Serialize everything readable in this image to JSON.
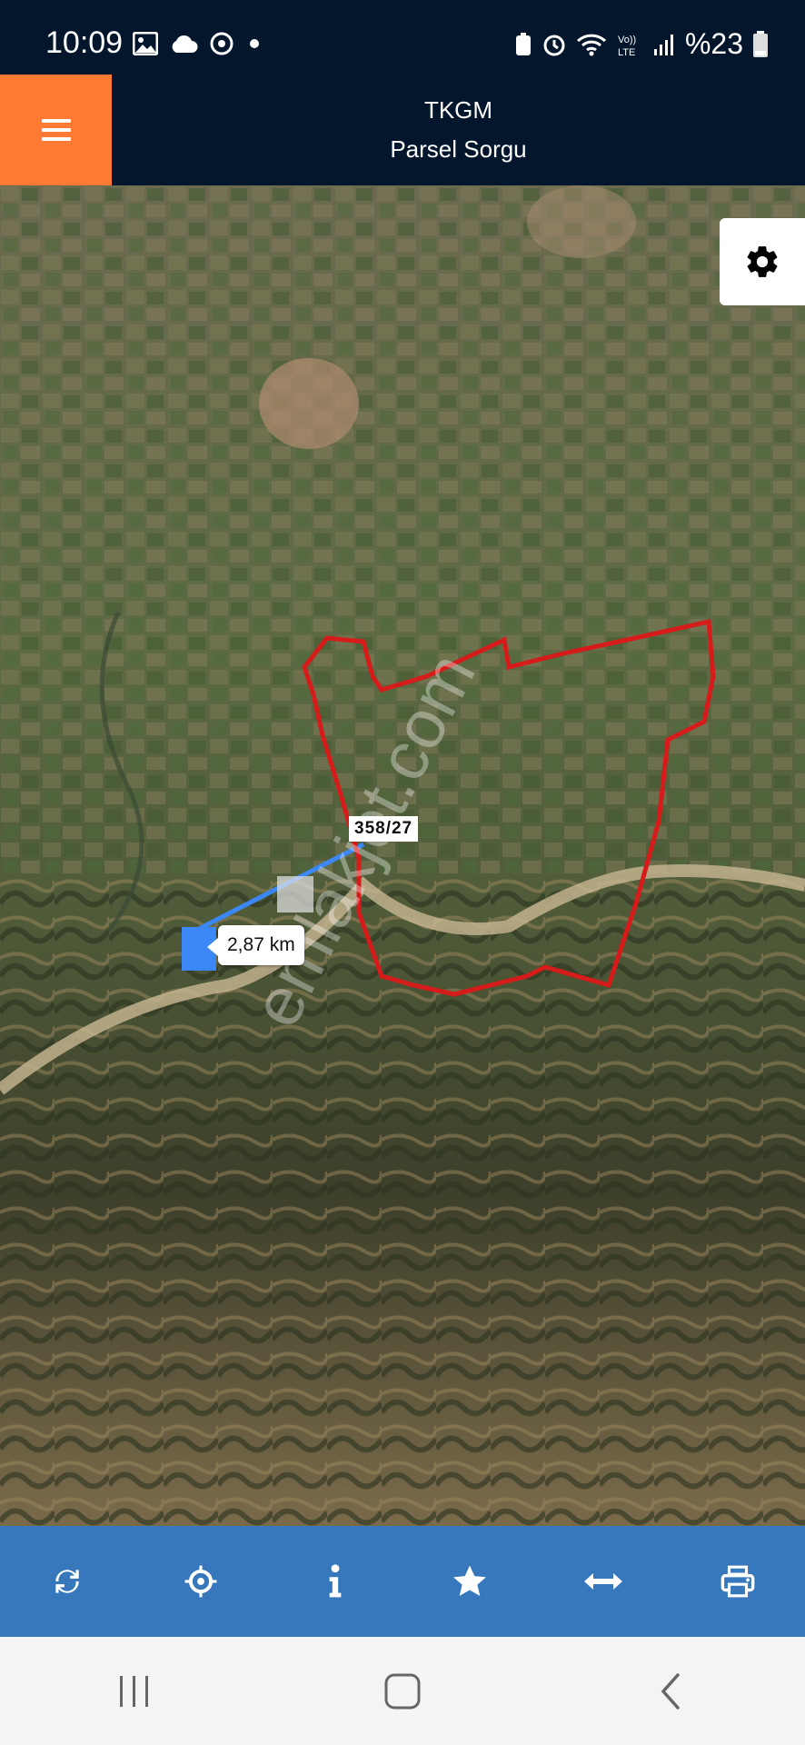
{
  "status_bar": {
    "time": "10:09",
    "battery_text": "%23",
    "icons": [
      "image-icon",
      "cloud-icon",
      "sync-icon",
      "dot-icon",
      "battery-saver-icon",
      "alarm-icon",
      "wifi-icon",
      "volte-icon",
      "signal-icon",
      "battery-icon"
    ]
  },
  "app_bar": {
    "title": "TKGM",
    "subtitle": "Parsel Sorgu",
    "menu_icon": "hamburger-icon",
    "accent_color": "#ff7a33",
    "background_color": "#03162b"
  },
  "map": {
    "parcel_label": "358/27",
    "distance_label": "2,87 km",
    "watermark": "emlakjet.com",
    "settings_icon": "gear-icon",
    "parcel_outline_color": "#d61b1b",
    "distance_line_color": "#3a87f5"
  },
  "toolbar": {
    "background_color": "#3678bb",
    "buttons": [
      {
        "icon": "refresh-icon"
      },
      {
        "icon": "crosshair-icon"
      },
      {
        "icon": "info-icon"
      },
      {
        "icon": "star-icon"
      },
      {
        "icon": "measure-icon"
      },
      {
        "icon": "print-icon"
      }
    ]
  },
  "nav_bar": {
    "buttons": [
      {
        "icon": "recent-apps-icon"
      },
      {
        "icon": "home-icon"
      },
      {
        "icon": "back-icon"
      }
    ]
  }
}
